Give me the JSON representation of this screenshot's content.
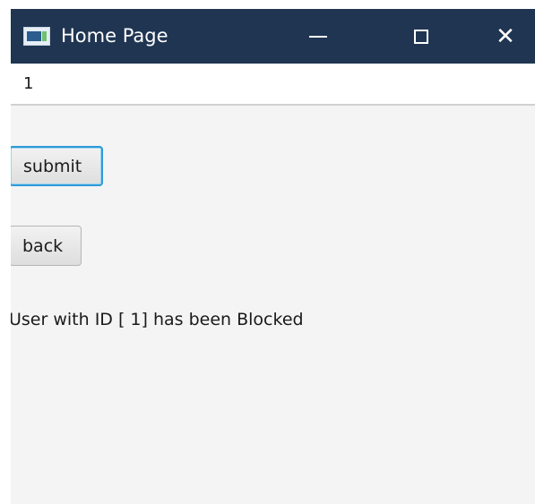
{
  "window": {
    "title": "Home Page",
    "icon": "app-window-icon",
    "controls": {
      "minimize": "minimize-icon",
      "maximize": "maximize-icon",
      "close_glyph": "✕"
    }
  },
  "form": {
    "id_value": "1",
    "submit_label": "submit",
    "back_label": "back",
    "message": "User with ID [ 1] has been Blocked"
  },
  "colors": {
    "titlebar": "#1f3552",
    "background": "#f4f4f4",
    "focus_border": "#2d9bd8"
  }
}
